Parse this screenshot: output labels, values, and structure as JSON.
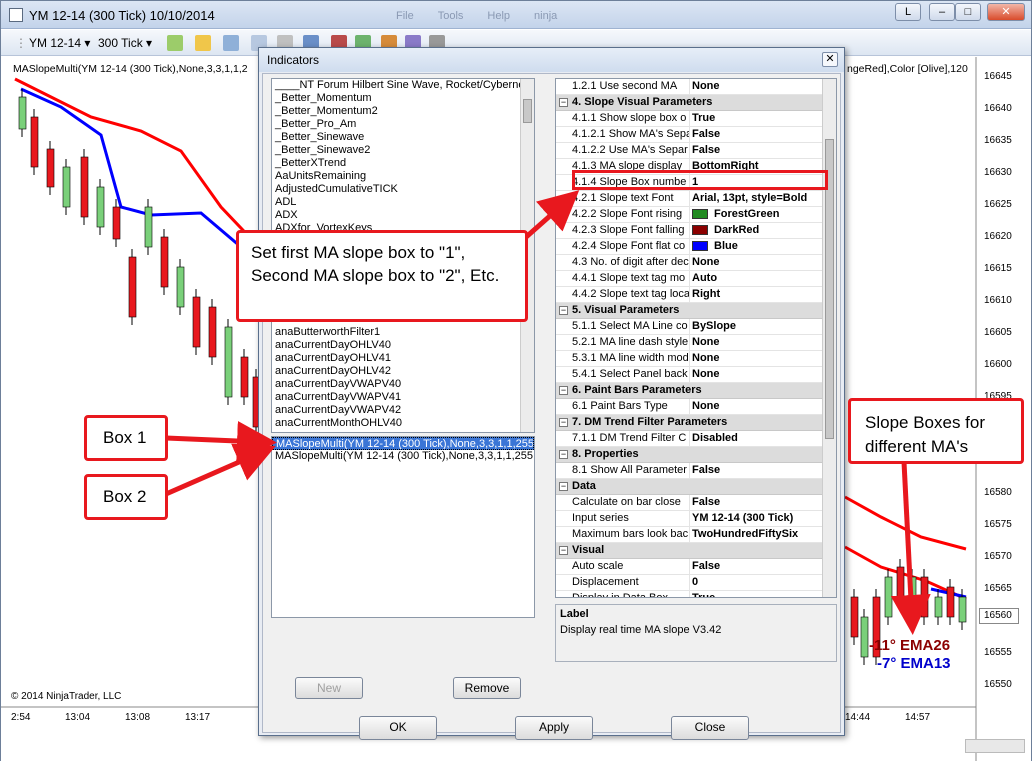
{
  "window": {
    "title": "YM 12-14 (300 Tick)  10/10/2014",
    "menus": [
      "File",
      "Tools",
      "Help",
      "ninja"
    ]
  },
  "toolbar": {
    "instrument": "YM 12-14",
    "period": "300 Tick"
  },
  "chart": {
    "indicator_label": "MASlopeMulti(YM 12-14 (300 Tick),None,3,3,1,1,2",
    "indicator_label_tail": "ngeRed],Color [Olive],120",
    "copyright": "© 2014 NinjaTrader, LLC",
    "price_axis": [
      "16645",
      "16640",
      "16635",
      "16630",
      "16625",
      "16620",
      "16615",
      "16610",
      "16605",
      "16600",
      "16595",
      "16590",
      "16585",
      "16580",
      "16575",
      "16570",
      "16565",
      "16560",
      "16555",
      "16550"
    ],
    "current_price": "16560",
    "time_axis": [
      "2:54",
      "13:04",
      "13:08",
      "13:17",
      "14:44",
      "14:57"
    ],
    "slope_text_1": "-11° EMA26",
    "slope_text_2": "-7° EMA13",
    "slope_color_falling": "#8b0000",
    "slope_color_flat": "#0000cc",
    "ema_fast_color": "#0000ff",
    "ema_slow_color": "#ff0000"
  },
  "dialog": {
    "title": "Indicators",
    "available_indicators": [
      "____NT Forum Hilbert Sine Wave, Rocket/Cybernetic",
      "_Better_Momentum",
      "_Better_Momentum2",
      "_Better_Pro_Am",
      "_Better_Sinewave",
      "_Better_Sinewave2",
      "_BetterXTrend",
      "AaUnitsRemaining",
      "AdjustedCumulativeTICK",
      "ADL",
      "ADX",
      "ADXfor_VortexKeys",
      "",
      "",
      "",
      "",
      "",
      "",
      "",
      "anaButterworthFilter1",
      "anaCurrentDayOHLV40",
      "anaCurrentDayOHLV41",
      "anaCurrentDayOHLV42",
      "anaCurrentDayVWAPV40",
      "anaCurrentDayVWAPV41",
      "anaCurrentDayVWAPV42",
      "anaCurrentMonthOHLV40"
    ],
    "applied_indicators": [
      "MASlopeMulti(YM 12-14 (300 Tick),None,3,3,1,1,255,Dis",
      "MASlopeMulti(YM 12-14 (300 Tick),None,3,3,1,1,255,Dis"
    ],
    "buttons": {
      "new": "New",
      "remove": "Remove",
      "ok": "OK",
      "apply": "Apply",
      "close": "Close"
    },
    "properties": [
      {
        "kind": "row",
        "key": "1.2.1 Use second MA",
        "value": "None"
      },
      {
        "kind": "cat",
        "label": "4. Slope Visual Parameters"
      },
      {
        "kind": "row",
        "key": "4.1.1 Show slope box o",
        "value": "True"
      },
      {
        "kind": "row",
        "key": "4.1.2.1 Show MA's Sepa",
        "value": "False"
      },
      {
        "kind": "row",
        "key": "4.1.2.2 Use MA's Separ",
        "value": "False"
      },
      {
        "kind": "row",
        "key": "4.1.3 MA slope display",
        "value": "BottomRight"
      },
      {
        "kind": "row",
        "key": "4.1.4 Slope Box numbe",
        "value": "1"
      },
      {
        "kind": "row",
        "key": "4.2.1 Slope text Font",
        "value": "Arial, 13pt, style=Bold"
      },
      {
        "kind": "row",
        "key": "4.2.2 Slope Font rising",
        "value": "ForestGreen",
        "swatch": "#228b22"
      },
      {
        "kind": "row",
        "key": "4.2.3 Slope Font falling",
        "value": "DarkRed",
        "swatch": "#8b0000"
      },
      {
        "kind": "row",
        "key": "4.2.4 Slope Font flat co",
        "value": "Blue",
        "swatch": "#0000ff"
      },
      {
        "kind": "row",
        "key": "4.3 No. of digit after dec",
        "value": "None"
      },
      {
        "kind": "row",
        "key": "4.4.1 Slope text tag mo",
        "value": "Auto"
      },
      {
        "kind": "row",
        "key": "4.4.2 Slope text tag loca",
        "value": "Right"
      },
      {
        "kind": "cat",
        "label": "5. Visual Parameters"
      },
      {
        "kind": "row",
        "key": "5.1.1 Select MA Line co",
        "value": "BySlope"
      },
      {
        "kind": "row",
        "key": "5.2.1 MA line dash style",
        "value": "None"
      },
      {
        "kind": "row",
        "key": "5.3.1 MA line width mod",
        "value": "None"
      },
      {
        "kind": "row",
        "key": "5.4.1 Select Panel back",
        "value": "None"
      },
      {
        "kind": "cat",
        "label": "6. Paint Bars Parameters"
      },
      {
        "kind": "row",
        "key": "6.1 Paint Bars Type",
        "value": "None"
      },
      {
        "kind": "cat",
        "label": "7. DM Trend Filter Parameters"
      },
      {
        "kind": "row",
        "key": "7.1.1 DM Trend Filter C",
        "value": "Disabled"
      },
      {
        "kind": "cat",
        "label": "8. Properties"
      },
      {
        "kind": "row",
        "key": "8.1 Show All Parameter",
        "value": "False"
      },
      {
        "kind": "cat",
        "label": "Data"
      },
      {
        "kind": "row",
        "key": "Calculate on bar close",
        "value": "False"
      },
      {
        "kind": "row",
        "key": "Input series",
        "value": "YM 12-14 (300 Tick)"
      },
      {
        "kind": "row",
        "key": "Maximum bars look bac",
        "value": "TwoHundredFiftySix"
      },
      {
        "kind": "cat",
        "label": "Visual"
      },
      {
        "kind": "row",
        "key": "Auto scale",
        "value": "False"
      },
      {
        "kind": "row",
        "key": "Displacement",
        "value": "0"
      },
      {
        "kind": "row",
        "key": "Display in Data Box",
        "value": "True"
      }
    ],
    "help_title": "Label",
    "help_text": "Display real time MA slope V3.42"
  },
  "callouts": {
    "main": "Set first MA slope box to \"1\", Second MA slope box to \"2\", Etc.",
    "box1": "Box 1",
    "box2": "Box 2",
    "slope_boxes": "Slope Boxes for different MA's"
  }
}
